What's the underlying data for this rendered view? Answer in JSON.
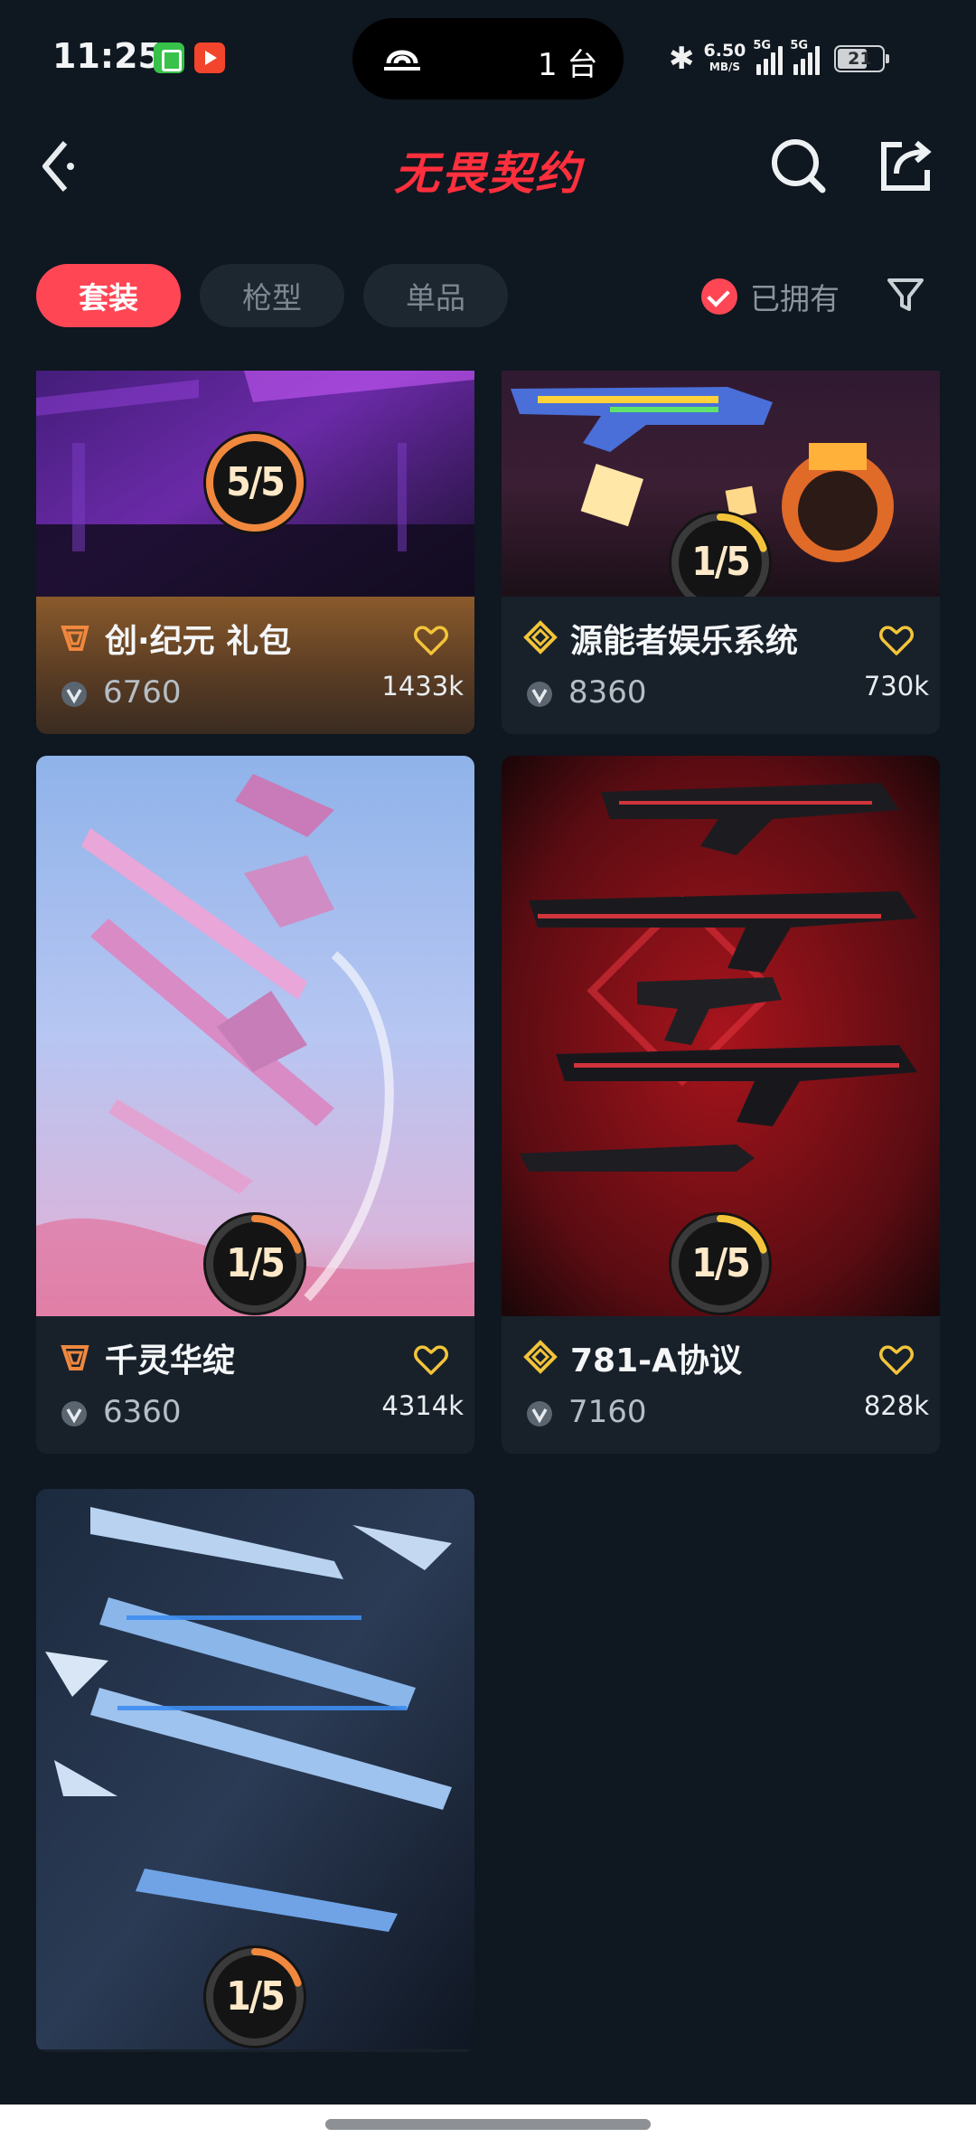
{
  "status_bar": {
    "time": "11:25",
    "cast_text": "1 台",
    "net_speed": "6.50",
    "net_unit": "MB/S",
    "signal1_tag": "5G",
    "signal2_tag": "5G",
    "battery": "21"
  },
  "header": {
    "title": "无畏契约",
    "back_icon": "chevron-left-icon",
    "search_icon": "search-icon",
    "share_icon": "share-icon"
  },
  "tabs": [
    {
      "label": "套装",
      "active": true
    },
    {
      "label": "枪型",
      "active": false
    },
    {
      "label": "单品",
      "active": false
    }
  ],
  "filter": {
    "owned_label": "已拥有",
    "owned_checked": true,
    "filter_icon": "filter-icon"
  },
  "cards": [
    {
      "name": "创·纪元 礼包",
      "price": "6760",
      "likes": "1433k",
      "progress_text": "5/5",
      "progress": 1.0,
      "ring_color": "#f0883e",
      "tier_color": "#f0883e"
    },
    {
      "name": "源能者娱乐系统",
      "price": "8360",
      "likes": "730k",
      "progress_text": "1/5",
      "progress": 0.2,
      "ring_color": "#f3c43a",
      "tier_color": "#f3c43a"
    },
    {
      "name": "千灵华绽",
      "price": "6360",
      "likes": "4314k",
      "progress_text": "1/5",
      "progress": 0.2,
      "ring_color": "#f0883e",
      "tier_color": "#f0883e"
    },
    {
      "name": "781-A协议",
      "price": "7160",
      "likes": "828k",
      "progress_text": "1/5",
      "progress": 0.2,
      "ring_color": "#f3c43a",
      "tier_color": "#f3c43a"
    },
    {
      "progress_text": "1/5",
      "progress": 0.2,
      "ring_color": "#f0883e"
    }
  ],
  "colors": {
    "accent": "#ff4655",
    "background": "#0f1720",
    "card": "#18212a",
    "favorite": "#f3c43a"
  }
}
